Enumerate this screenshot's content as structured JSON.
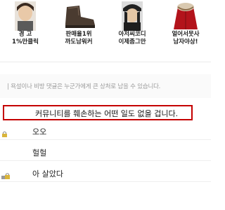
{
  "ads": [
    {
      "line1": "경 고",
      "line2": "1%만클릭",
      "icon": "person-photo-icon"
    },
    {
      "line1": "판매율1위",
      "line2": "까도남워커",
      "icon": "boot-photo-icon"
    },
    {
      "line1": "아저씨코디",
      "line2": "이제좀그만",
      "icon": "person-hat-photo-icon"
    },
    {
      "line1": "얼어서뭇사",
      "line2": "남자야상!",
      "icon": "parka-photo-icon"
    }
  ],
  "notice": "| 욕설이나 비방 댓글은 누군가에게 큰 상처로 남을 수 있습니다.",
  "highlight_text": "커뮤니티를 훼손하는 어떤 일도 없을 겁니다.",
  "comments": [
    {
      "text": "오오",
      "icon": "lock-icon"
    },
    {
      "text": "헐헐",
      "icon": ""
    },
    {
      "text": "아 살았다",
      "icon": "lock-icon"
    }
  ],
  "colors": {
    "highlight_border": "#c40000",
    "notice_text": "#9a9a9a"
  }
}
